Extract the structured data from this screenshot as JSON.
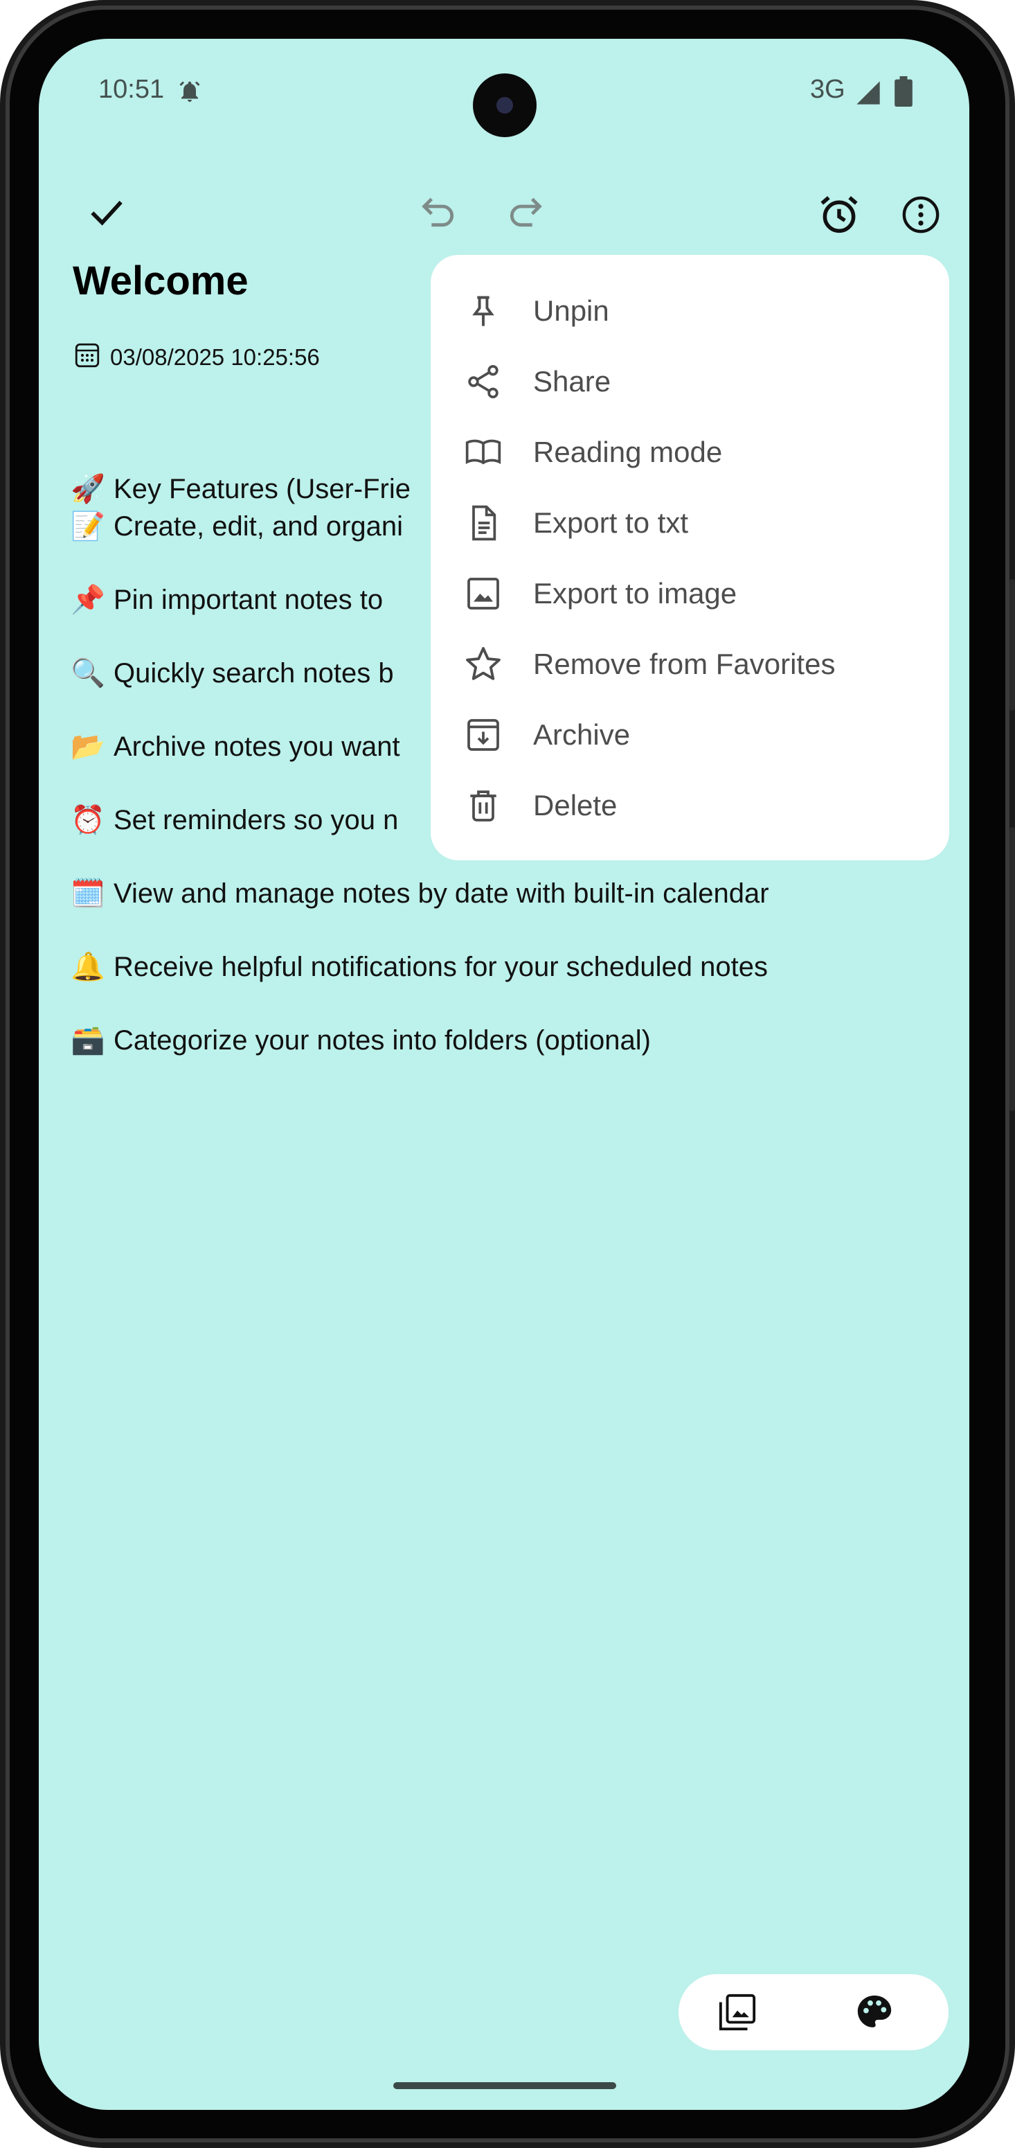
{
  "status_bar": {
    "time": "10:51",
    "network": "3G",
    "icons": [
      "alarm-bell-icon",
      "signal-icon",
      "battery-icon"
    ]
  },
  "toolbar": {
    "icons": [
      "check-icon",
      "undo-icon",
      "redo-icon",
      "alarm-clock-icon",
      "more-options-icon"
    ]
  },
  "note": {
    "title": "Welcome",
    "date": "03/08/2025 10:25:56",
    "lines": [
      {
        "emoji": "🚀",
        "text": "Key Features (User-Frie"
      },
      {
        "emoji": "📝",
        "text": "Create, edit, and organi"
      },
      {
        "emoji": "📌",
        "text": "Pin important notes to"
      },
      {
        "emoji": "🔍",
        "text": "Quickly search notes b"
      },
      {
        "emoji": "📂",
        "text": "Archive notes you want"
      },
      {
        "emoji": "⏰",
        "text": "Set reminders so you n"
      },
      {
        "emoji": "🗓️",
        "text": "View and manage notes by date with built-in calendar"
      },
      {
        "emoji": "🔔",
        "text": "Receive helpful notifications for your scheduled notes"
      },
      {
        "emoji": "🗃️",
        "text": "Categorize your notes into folders (optional)"
      }
    ]
  },
  "menu": {
    "items": [
      {
        "label": "Unpin",
        "icon": "pin-icon"
      },
      {
        "label": "Share",
        "icon": "share-icon"
      },
      {
        "label": "Reading mode",
        "icon": "book-icon"
      },
      {
        "label": "Export to txt",
        "icon": "document-icon"
      },
      {
        "label": "Export to image",
        "icon": "image-icon"
      },
      {
        "label": "Remove from Favorites",
        "icon": "star-icon"
      },
      {
        "label": "Archive",
        "icon": "archive-icon"
      },
      {
        "label": "Delete",
        "icon": "trash-icon"
      }
    ]
  },
  "bottom_bar": {
    "icons": [
      "gallery-icon",
      "palette-icon"
    ]
  },
  "colors": {
    "background": "#bdf1eb",
    "menu_bg": "#ffffff",
    "menu_text": "#4d4d4d"
  }
}
